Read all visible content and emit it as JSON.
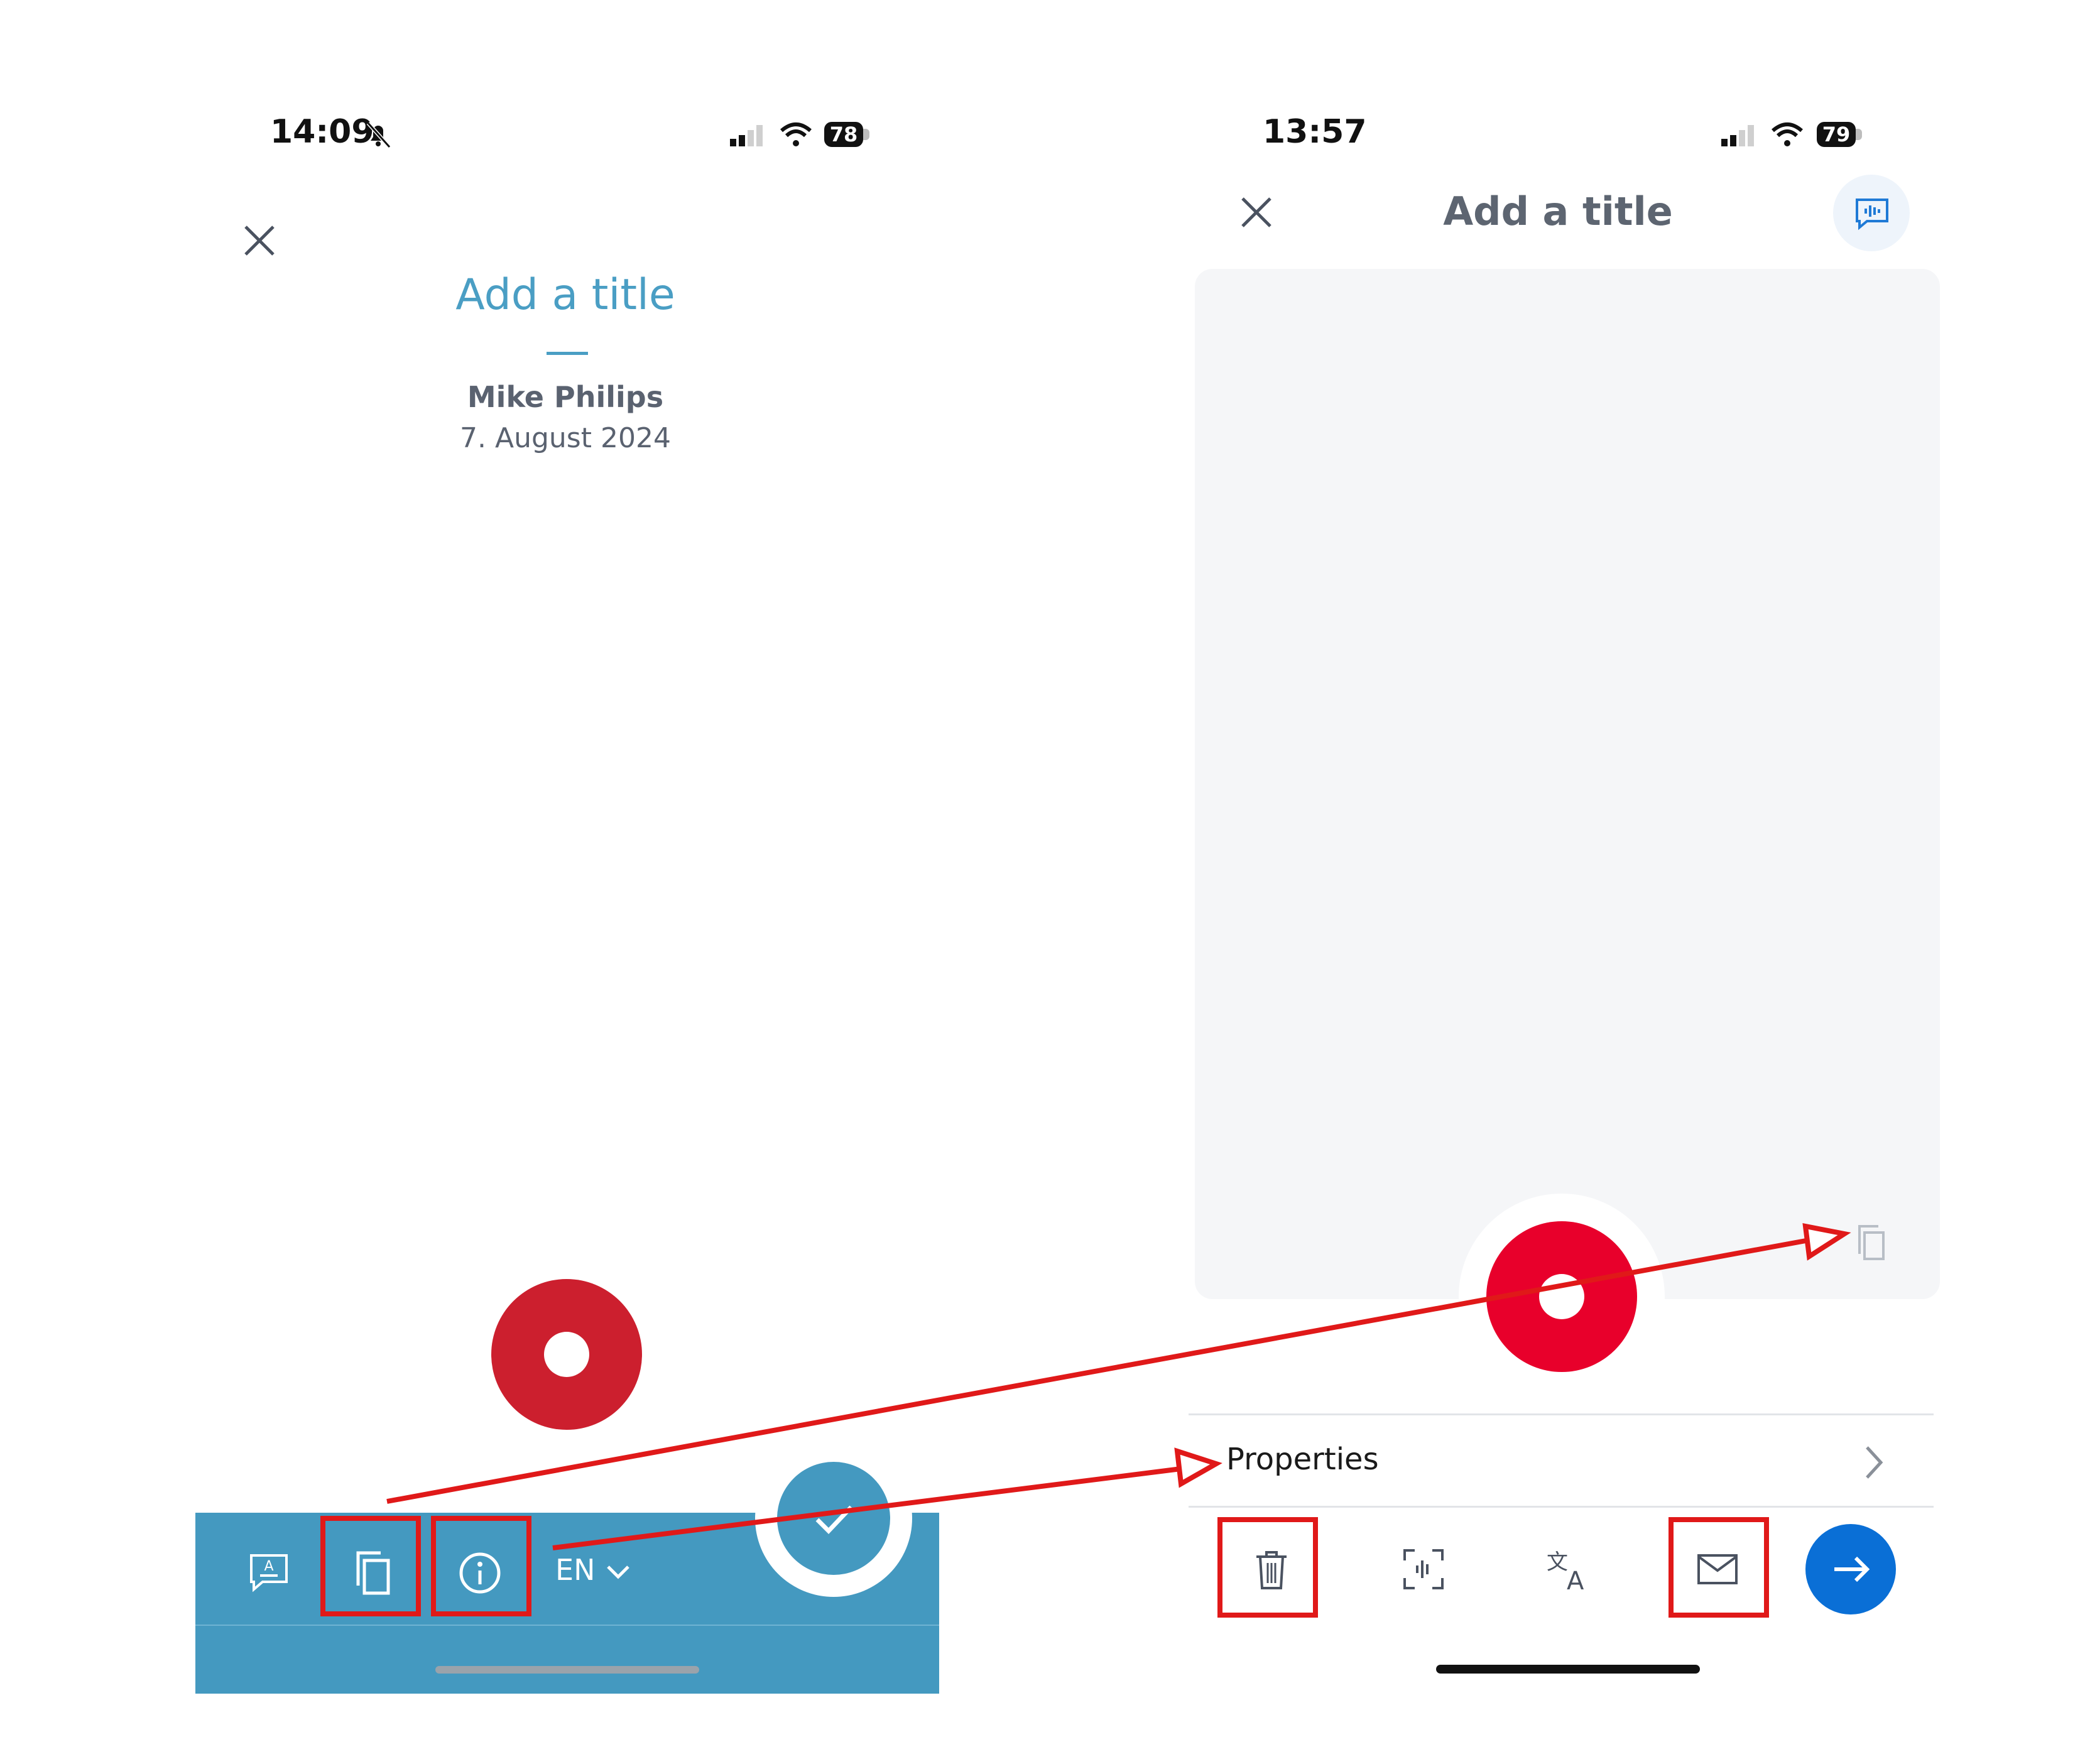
{
  "left_phone": {
    "status_time": "14:09",
    "battery": "78",
    "title": "Add a title",
    "author": "Mike Philips",
    "date": "7. August 2024",
    "language": "EN",
    "icons": [
      "close-icon",
      "bell-muted-icon",
      "signal-icon",
      "wifi-icon",
      "summary-icon",
      "copy-icon",
      "info-icon",
      "chevron-down-icon",
      "check-icon",
      "record-icon"
    ]
  },
  "right_phone": {
    "status_time": "13:57",
    "battery": "79",
    "title": "Add a title",
    "properties_label": "Properties",
    "icons": [
      "close-icon",
      "feedback-icon",
      "copy-icon",
      "record-icon",
      "chevron-right-icon",
      "trash-icon",
      "voice-scan-icon",
      "translate-icon",
      "mail-icon",
      "arrow-right-icon"
    ]
  },
  "colors": {
    "toolbar_blue": "#4499c0",
    "title_blue": "#4a9ec4",
    "record_red_left": "#cc1f2e",
    "record_red_right": "#e8002b",
    "primary_blue": "#0a6fd6",
    "annotation_red": "#e01919"
  }
}
